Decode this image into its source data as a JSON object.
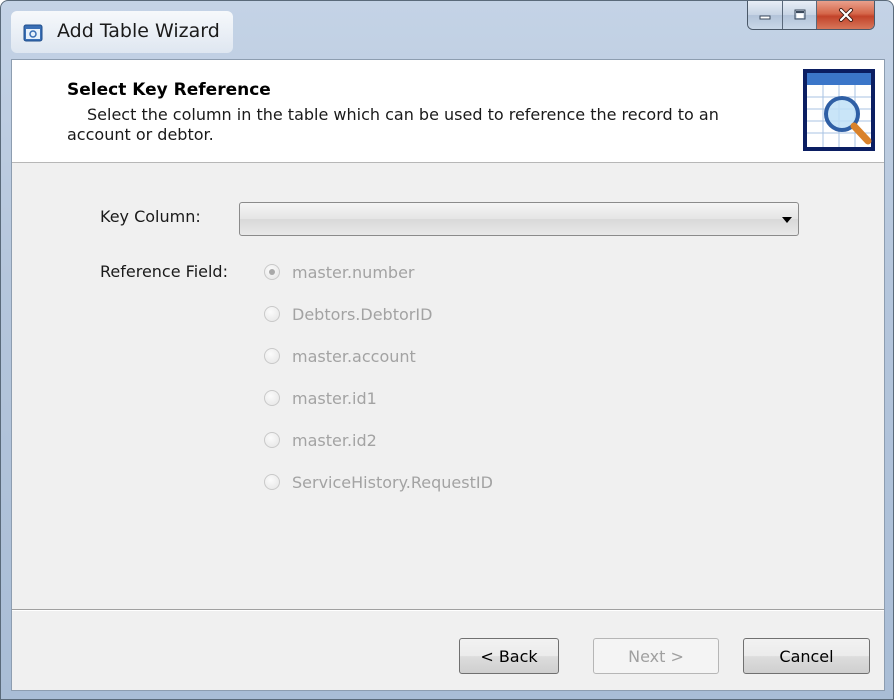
{
  "window": {
    "title": "Add Table Wizard",
    "icon": "table-window-icon",
    "controls": [
      "minimize-icon",
      "maximize-icon",
      "close-icon"
    ]
  },
  "header": {
    "title": "Select Key Reference",
    "description": "Select the column in the table which can be used to reference the record to an account or debtor.",
    "icon": "table-search-icon"
  },
  "form": {
    "key_column_label": "Key Column:",
    "key_column_value": "",
    "reference_field_label": "Reference Field:",
    "reference_options": [
      {
        "label": "master.number",
        "checked": true,
        "enabled": false
      },
      {
        "label": "Debtors.DebtorID",
        "checked": false,
        "enabled": false
      },
      {
        "label": "master.account",
        "checked": false,
        "enabled": false
      },
      {
        "label": "master.id1",
        "checked": false,
        "enabled": false
      },
      {
        "label": "master.id2",
        "checked": false,
        "enabled": false
      },
      {
        "label": "ServiceHistory.RequestID",
        "checked": false,
        "enabled": false
      }
    ]
  },
  "footer": {
    "back_label": "< Back",
    "next_label": "Next >",
    "cancel_label": "Cancel",
    "next_enabled": false
  },
  "colors": {
    "disabled_text": "#a3a3a3",
    "close_button": "#c9452c",
    "frame": "#b5c6dc"
  }
}
